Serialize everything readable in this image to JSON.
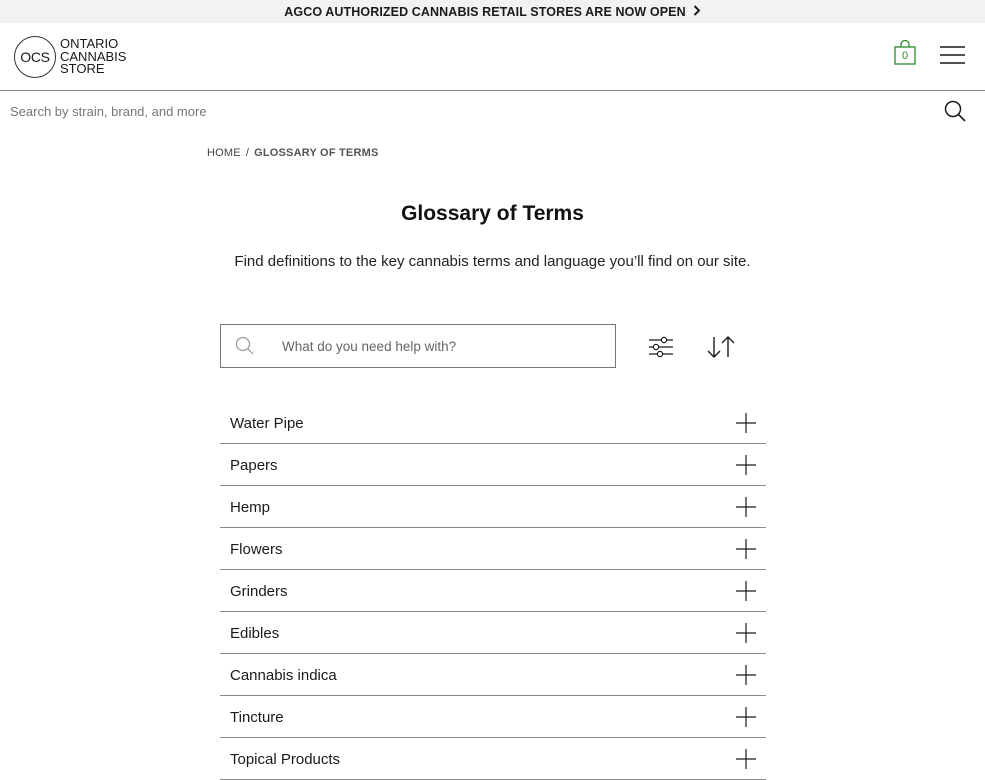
{
  "announcement": {
    "text": "AGCO AUTHORIZED CANNABIS RETAIL STORES ARE NOW OPEN",
    "chevron": "›"
  },
  "header": {
    "logo": {
      "mark": "OCS",
      "line1": "ONTARIO",
      "line2": "CANNABIS",
      "line3": "STORE"
    },
    "cart_count": "0",
    "cart_icon": "shopping-bag-icon",
    "menu_icon": "hamburger-menu-icon",
    "accent_color": "#2a8a2a"
  },
  "search": {
    "placeholder": "Search by strain, brand, and more",
    "icon": "search-icon"
  },
  "breadcrumb": {
    "home": "HOME",
    "separator": "/",
    "current": "GLOSSARY OF TERMS"
  },
  "page": {
    "title": "Glossary of Terms",
    "subtitle": "Find definitions to the key cannabis terms and language you’ll find on our site."
  },
  "help_search": {
    "placeholder": "What do you need help with?"
  },
  "controls": {
    "filter_icon": "sliders-icon",
    "sort_icon": "sort-arrows-icon"
  },
  "glossary": {
    "items": [
      {
        "label": "Water Pipe"
      },
      {
        "label": "Papers"
      },
      {
        "label": "Hemp"
      },
      {
        "label": "Flowers"
      },
      {
        "label": "Grinders"
      },
      {
        "label": "Edibles"
      },
      {
        "label": "Cannabis indica"
      },
      {
        "label": "Tincture"
      },
      {
        "label": "Topical Products"
      }
    ]
  }
}
